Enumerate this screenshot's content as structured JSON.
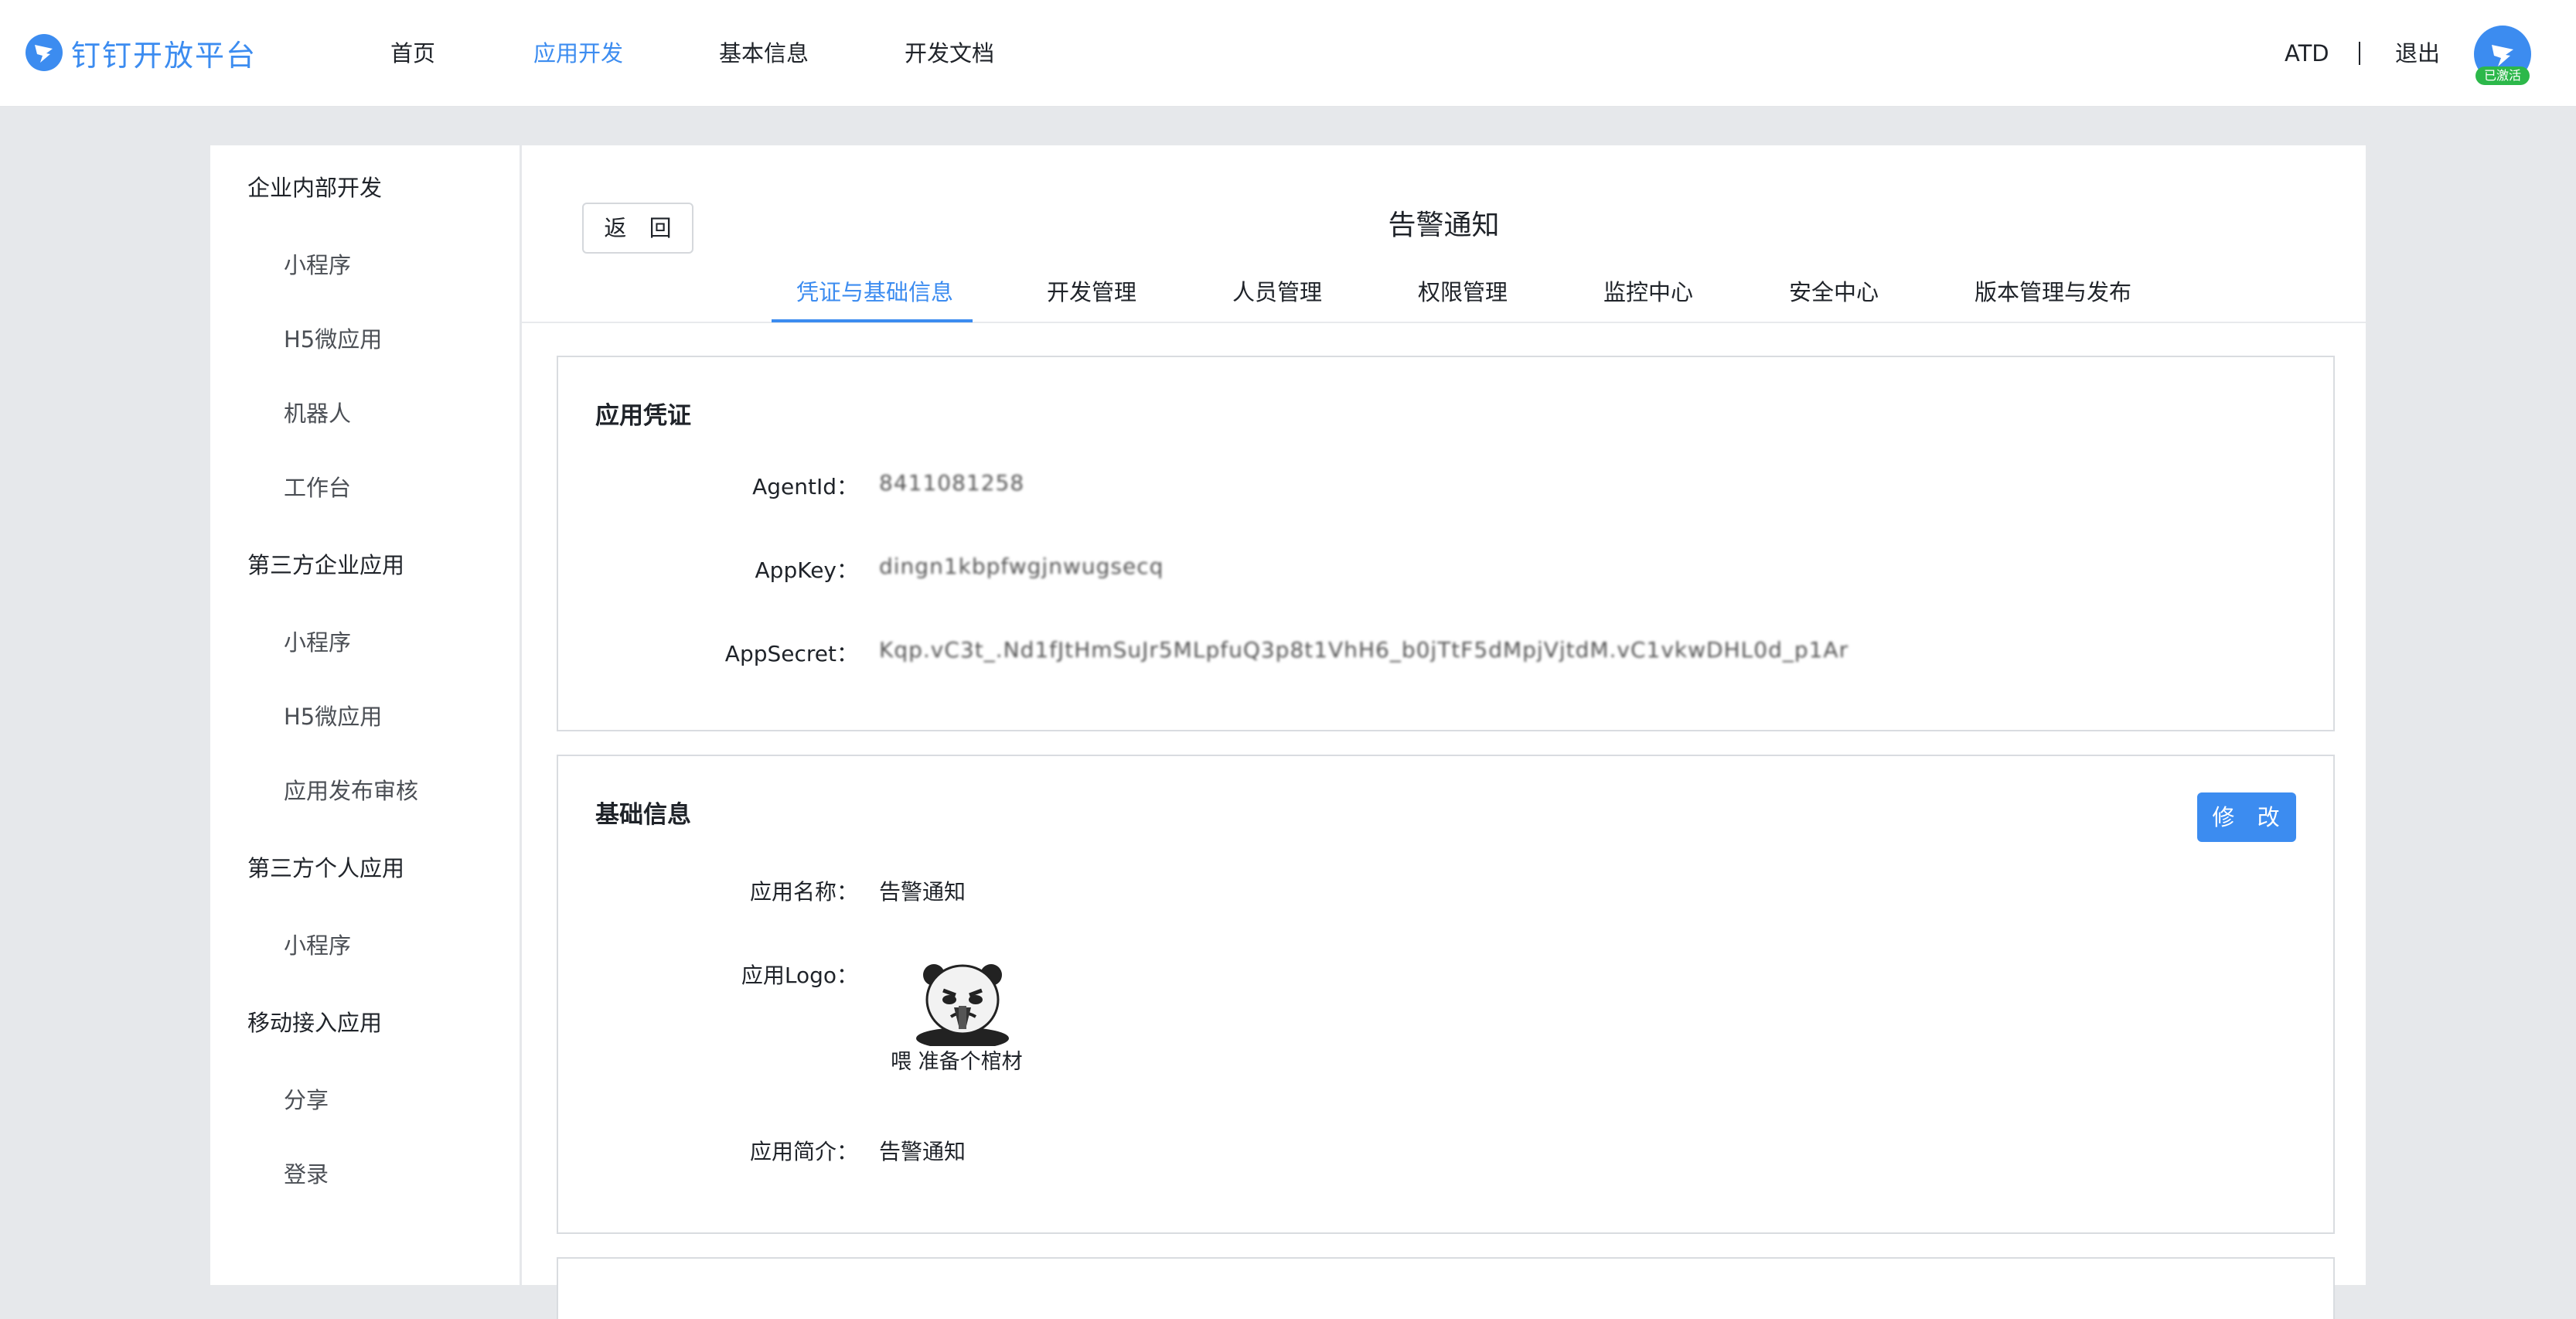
{
  "header": {
    "brand": "钉钉开放平台",
    "nav": [
      {
        "label": "首页",
        "active": false
      },
      {
        "label": "应用开发",
        "active": true
      },
      {
        "label": "基本信息",
        "active": false
      },
      {
        "label": "开发文档",
        "active": false
      }
    ],
    "user_name": "ATD",
    "logout_label": "退出",
    "avatar_badge": "已激活",
    "accent_color": "#3c8cf0"
  },
  "sidebar": {
    "groups": [
      {
        "label": "企业内部开发",
        "items": [
          "小程序",
          "H5微应用",
          "机器人",
          "工作台"
        ]
      },
      {
        "label": "第三方企业应用",
        "items": [
          "小程序",
          "H5微应用",
          "应用发布审核"
        ]
      },
      {
        "label": "第三方个人应用",
        "items": [
          "小程序"
        ]
      },
      {
        "label": "移动接入应用",
        "items": [
          "分享",
          "登录"
        ]
      }
    ]
  },
  "main": {
    "back_label": "返 回",
    "app_title": "告警通知",
    "tabs": [
      {
        "label": "凭证与基础信息",
        "active": true
      },
      {
        "label": "开发管理",
        "active": false
      },
      {
        "label": "人员管理",
        "active": false
      },
      {
        "label": "权限管理",
        "active": false
      },
      {
        "label": "监控中心",
        "active": false
      },
      {
        "label": "安全中心",
        "active": false
      },
      {
        "label": "版本管理与发布",
        "active": false
      }
    ],
    "credentials": {
      "title": "应用凭证",
      "fields": [
        {
          "label": "AgentId：",
          "value": "8411081258"
        },
        {
          "label": "AppKey：",
          "value": "dingn1kbpfwgjnwugsecq"
        },
        {
          "label": "AppSecret：",
          "value": "Kqp.vC3t_.Nd1fJtHmSuJr5MLpfuQ3p8t1VhH6_b0jTtF5dMpjVjtdM.vC1vkwDHL0d_p1Ar"
        }
      ]
    },
    "basic_info": {
      "title": "基础信息",
      "edit_label": "修 改",
      "name_label": "应用名称：",
      "name_value": "告警通知",
      "logo_label": "应用Logo：",
      "logo_caption": "喂 准备个棺材",
      "desc_label": "应用简介：",
      "desc_value": "告警通知"
    }
  }
}
